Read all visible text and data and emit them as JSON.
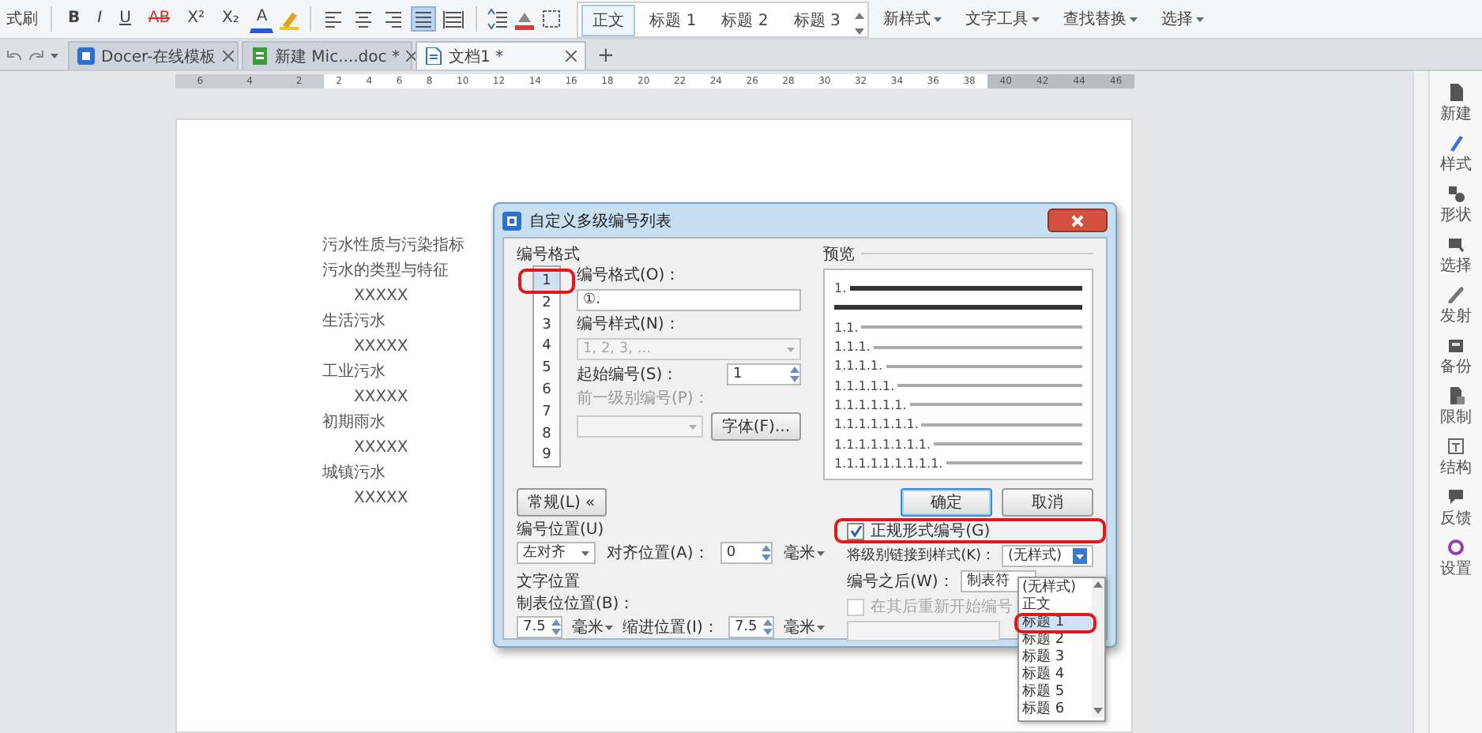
{
  "toolbar": {
    "format_painter": "式刷",
    "font_buttons": [
      {
        "label": "B",
        "kind": "bold"
      },
      {
        "label": "I",
        "kind": "italic"
      },
      {
        "label": "U",
        "kind": "underline"
      },
      {
        "label": "AB",
        "kind": "strike"
      },
      {
        "label": "X²",
        "kind": "plain"
      },
      {
        "label": "X₂",
        "kind": "plain"
      },
      {
        "label": "A",
        "kind": "color"
      }
    ],
    "align_buttons": [
      {
        "kind": "left",
        "selected": false
      },
      {
        "kind": "center",
        "selected": false
      },
      {
        "kind": "right",
        "selected": false
      },
      {
        "kind": "justify",
        "selected": true
      },
      {
        "kind": "distribute",
        "selected": false
      }
    ],
    "styles": [
      {
        "label": "正文",
        "selected": true
      },
      {
        "label": "标题 1",
        "selected": false
      },
      {
        "label": "标题 2",
        "selected": false
      },
      {
        "label": "标题 3",
        "selected": false
      }
    ],
    "menus": [
      "新样式",
      "文字工具",
      "查找替换",
      "选择"
    ]
  },
  "tabs": [
    {
      "label": "Docer-在线模板",
      "kind": "docer",
      "selected": false
    },
    {
      "label": "新建 Mic....doc *",
      "kind": "doc",
      "selected": false
    },
    {
      "label": "文档1 *",
      "kind": "writer",
      "selected": true
    }
  ],
  "new_tab": "+",
  "ruler": {
    "left_labels": [
      "6",
      "4",
      "2"
    ],
    "main_labels": [
      "2",
      "4",
      "6",
      "8",
      "10",
      "12",
      "14",
      "16",
      "18",
      "20",
      "22",
      "24",
      "26",
      "28",
      "30",
      "32",
      "34",
      "36",
      "38"
    ],
    "right_labels": [
      "40",
      "42",
      "44",
      "46"
    ]
  },
  "document": {
    "lines": [
      {
        "text": "污水性质与污染指标",
        "indented": false
      },
      {
        "text": "污水的类型与特征",
        "indented": false
      },
      {
        "text": "XXXXX",
        "indented": true
      },
      {
        "text": "生活污水",
        "indented": false
      },
      {
        "text": "XXXXX",
        "indented": true
      },
      {
        "text": "工业污水",
        "indented": false
      },
      {
        "text": "XXXXX",
        "indented": true
      },
      {
        "text": "初期雨水",
        "indented": false
      },
      {
        "text": "XXXXX",
        "indented": true
      },
      {
        "text": "城镇污水",
        "indented": false
      },
      {
        "text": "XXXXX",
        "indented": true
      }
    ]
  },
  "sidebar": {
    "items": [
      {
        "label": "新建",
        "kind": "new"
      },
      {
        "label": "样式",
        "kind": "style"
      },
      {
        "label": "形状",
        "kind": "shape"
      },
      {
        "label": "选择",
        "kind": "select"
      },
      {
        "label": "发射",
        "kind": "send"
      },
      {
        "label": "备份",
        "kind": "backup"
      },
      {
        "label": "限制",
        "kind": "limit"
      },
      {
        "label": "结构",
        "kind": "structure"
      },
      {
        "label": "反馈",
        "kind": "feedback"
      },
      {
        "label": "设置",
        "kind": "settings"
      }
    ]
  },
  "dialog": {
    "title": "自定义多级编号列表",
    "format_group": "编号格式",
    "levels": [
      {
        "label": "1",
        "selected": true,
        "highlighted": true
      },
      {
        "label": "2",
        "selected": false,
        "highlighted": false
      },
      {
        "label": "3",
        "selected": false,
        "highlighted": false
      },
      {
        "label": "4",
        "selected": false,
        "highlighted": false
      },
      {
        "label": "5",
        "selected": false,
        "highlighted": false
      },
      {
        "label": "6",
        "selected": false,
        "highlighted": false
      },
      {
        "label": "7",
        "selected": false,
        "highlighted": false
      },
      {
        "label": "8",
        "selected": false,
        "highlighted": false
      },
      {
        "label": "9",
        "selected": false,
        "highlighted": false
      }
    ],
    "number_format": {
      "label": "编号格式(O)：",
      "value": "①."
    },
    "number_style": {
      "label": "编号样式(N)：",
      "value": "1, 2, 3, ...",
      "disabled": true
    },
    "start_at": {
      "label": "起始编号(S)：",
      "value": "1"
    },
    "prev_level": {
      "label": "前一级别编号(P)：",
      "disabled": true
    },
    "font_button": "字体(F)...",
    "preview": {
      "title": "预览",
      "lines": [
        {
          "prefix": "1.",
          "bold": true
        },
        {
          "bold": true
        },
        {
          "prefix": "1.1.",
          "bold": false
        },
        {
          "prefix": "1.1.1.",
          "bold": false
        },
        {
          "prefix": "1.1.1.1.",
          "bold": false
        },
        {
          "prefix": "1.1.1.1.1.",
          "bold": false
        },
        {
          "prefix": "1.1.1.1.1.1.",
          "bold": false
        },
        {
          "prefix": "1.1.1.1.1.1.1.",
          "bold": false
        },
        {
          "prefix": "1.1.1.1.1.1.1.1.",
          "bold": false
        },
        {
          "prefix": "1.1.1.1.1.1.1.1.1.",
          "bold": false
        }
      ]
    },
    "general_button": "常规(L) «",
    "ok_button": "确定",
    "cancel_button": "取消",
    "position": {
      "label": "编号位置(U)",
      "align": "左对齐",
      "align_at_label": "对齐位置(A)：",
      "align_at": "0",
      "unit": "毫米"
    },
    "text_position": {
      "title": "文字位置",
      "tab_label": "制表位位置(B)：",
      "tab_value": "7.5",
      "tab_unit": "毫米",
      "indent_label": "缩进位置(I)：",
      "indent_value": "7.5",
      "indent_unit": "毫米"
    },
    "legal": {
      "label": "正规形式编号(G)",
      "checked": true,
      "highlighted": true
    },
    "link_style": {
      "label": "将级别链接到样式(K)：",
      "value": "(无样式)"
    },
    "after": {
      "label": "编号之后(W)：",
      "value": "制表符"
    },
    "restart": {
      "label": "在其后重新开始编号",
      "checked": false,
      "disabled": true
    },
    "dropdown": {
      "options": [
        {
          "label": "(无样式)",
          "selected": false,
          "highlighted": false
        },
        {
          "label": "正文",
          "selected": false,
          "highlighted": false
        },
        {
          "label": "标题 1",
          "selected": true,
          "highlighted": true
        },
        {
          "label": "标题 2",
          "selected": false,
          "highlighted": false
        },
        {
          "label": "标题 3",
          "selected": false,
          "highlighted": false
        },
        {
          "label": "标题 4",
          "selected": false,
          "highlighted": false
        },
        {
          "label": "标题 5",
          "selected": false,
          "highlighted": false
        },
        {
          "label": "标题 6",
          "selected": false,
          "highlighted": false
        }
      ]
    }
  }
}
